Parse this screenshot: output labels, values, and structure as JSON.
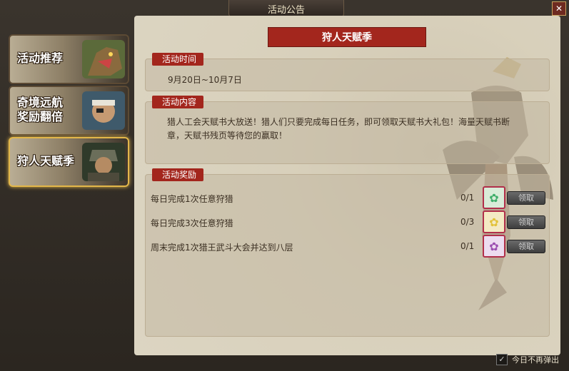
{
  "window": {
    "title": "活动公告",
    "close_glyph": "✕"
  },
  "sidebar": {
    "items": [
      {
        "label": "活动推荐",
        "active": false
      },
      {
        "label": "奇境远航\n奖励翻倍",
        "line1": "奇境远航",
        "line2": "奖励翻倍",
        "active": false
      },
      {
        "label": "狩人天赋季",
        "active": true
      }
    ]
  },
  "main": {
    "banner": "狩人天赋季",
    "time": {
      "tag": "活动时间",
      "value": "9月20日~10月7日"
    },
    "content": {
      "tag": "活动内容",
      "line1": "猎人工会天赋书大放送！猎人们只要完成每日任务，即可领取天赋书大礼包！海量天赋书断",
      "line2": "章，天赋书残页等待您的赢取！"
    },
    "rewards": {
      "tag": "活动奖励",
      "rows": [
        {
          "label": "每日完成1次任意狩猎",
          "count": "0/1",
          "bag_color": "#3fae6a",
          "button": "领取"
        },
        {
          "label": "每日完成3次任意狩猎",
          "count": "0/3",
          "bag_color": "#e2c23a",
          "button": "领取"
        },
        {
          "label": "周末完成1次猎王武斗大会并达到八层",
          "count": "0/1",
          "bag_color": "#9b4fb0",
          "button": "领取"
        }
      ]
    }
  },
  "footer": {
    "label": "今日不再弹出",
    "checked": true
  }
}
